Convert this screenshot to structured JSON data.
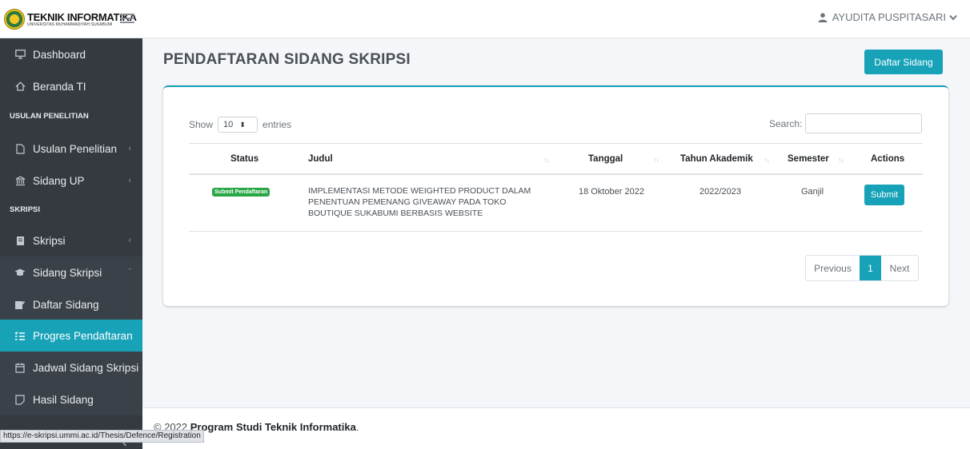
{
  "brand": {
    "title": "TEKNIK INFORMATIKA",
    "subtitle": "UNIVERSITAS MUHAMMADIYAH SUKABUMI"
  },
  "header": {
    "user_name": "AYUDITA PUSPITASARI",
    "user_icon": "user-icon",
    "menu_icon": "hamburger-icon"
  },
  "sidebar": {
    "dashboard": "Dashboard",
    "beranda": "Beranda TI",
    "section_usulan": "USULAN PENELITIAN",
    "usulan_penelitian": "Usulan Penelitian",
    "sidang_up": "Sidang UP",
    "section_skripsi": "SKRIPSI",
    "skripsi": "Skripsi",
    "sidang_skripsi": "Sidang Skripsi",
    "daftar_sidang": "Daftar Sidang",
    "progres_pendaftaran": "Progres Pendaftaran",
    "jadwal_sidang": "Jadwal Sidang Skripsi",
    "hasil_sidang": "Hasil Sidang"
  },
  "main": {
    "title": "PENDAFTARAN SIDANG SKRIPSI",
    "daftar_button": "Daftar Sidang",
    "show_label": "Show",
    "page_length": "10",
    "entries_label": "entries",
    "search_label": "Search:",
    "search_value": ""
  },
  "table": {
    "headers": {
      "status": "Status",
      "judul": "Judul",
      "tanggal": "Tanggal",
      "tahun": "Tahun Akademik",
      "semester": "Semester",
      "actions": "Actions"
    },
    "rows": [
      {
        "status": "Submit Pendaftaran",
        "judul": "IMPLEMENTASI METODE WEIGHTED PRODUCT DALAM PENENTUAN PEMENANG GIVEAWAY PADA TOKO BOUTIQUE SUKABUMI BERBASIS WEBSITE",
        "tanggal": "18 Oktober 2022",
        "tahun": "2022/2023",
        "semester": "Ganjil",
        "action": "Submit"
      }
    ]
  },
  "pagination": {
    "previous": "Previous",
    "current": "1",
    "next": "Next"
  },
  "footer": {
    "prefix": "© 2022",
    "org": "Program Studi Teknik Informatika",
    "suffix": "."
  },
  "status_url": "https://e-skripsi.ummi.ac.id/Thesis/Defence/Registration",
  "colors": {
    "accent": "#17a2b8",
    "sidebar": "#343a40",
    "badge_success": "#28a745"
  }
}
